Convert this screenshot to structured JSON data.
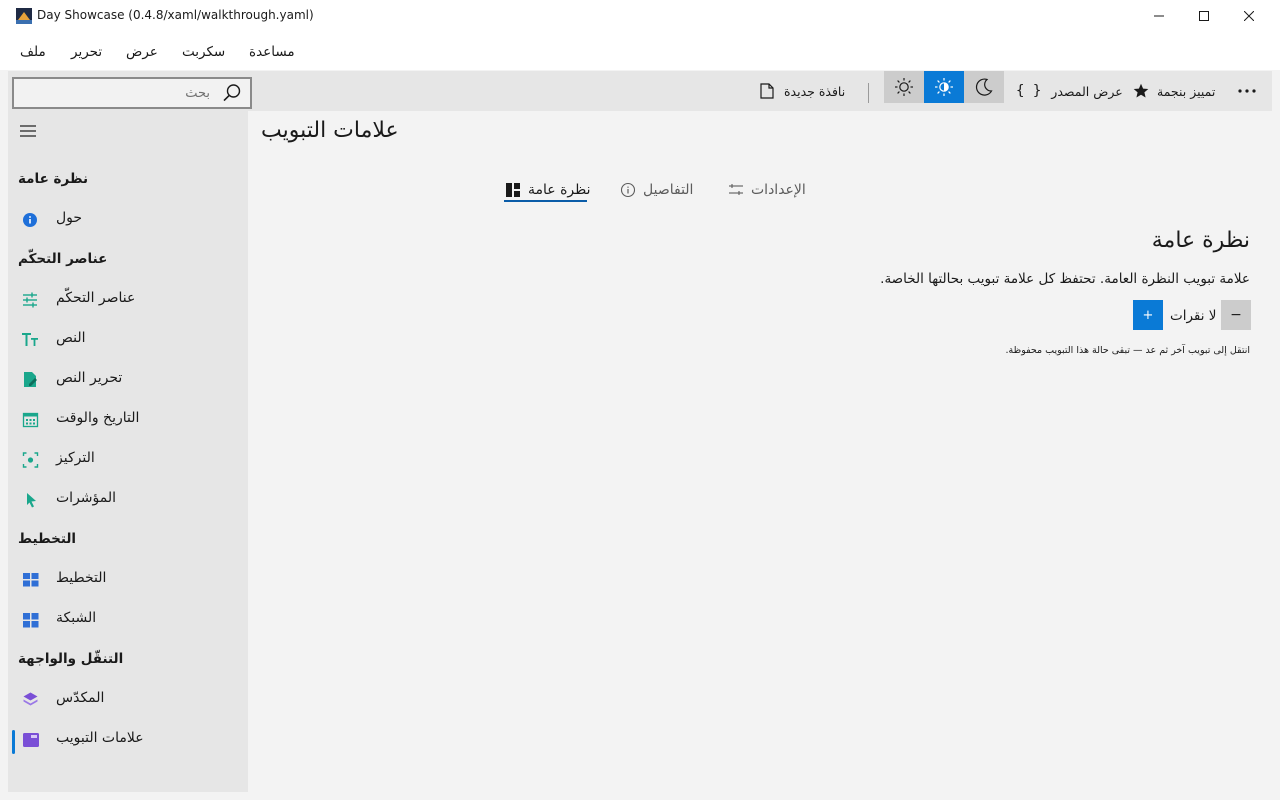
{
  "window": {
    "title": "Day Showcase (0.4.8/xaml/walkthrough.yaml)",
    "app_icon": "app-logo-icon"
  },
  "menu": {
    "file": "ملف",
    "edit": "تحرير",
    "view": "عرض",
    "script": "سكربت",
    "help": "مساعدة"
  },
  "toolbar": {
    "search_placeholder": "بحث",
    "new_window": "نافذة جديدة",
    "view_source": "عرض المصدر",
    "star": "تمييز بنجمة",
    "accent": "#0a7ad6"
  },
  "sidebar": {
    "headers": {
      "overview": "نظرة عامة",
      "controls": "عناصر التحكّم",
      "layout": "التخطيط",
      "navigation": "التنقّل والواجهة"
    },
    "items": [
      {
        "label": "حول",
        "icon": "info-icon",
        "color": "#1e6fd9"
      },
      {
        "label": "عناصر التحكّم",
        "icon": "sliders-icon",
        "color": "#1aa78c"
      },
      {
        "label": "النص",
        "icon": "text-size-icon",
        "color": "#1aa78c"
      },
      {
        "label": "تحرير النص",
        "icon": "edit-document-icon",
        "color": "#1aa78c"
      },
      {
        "label": "التاريخ والوقت",
        "icon": "calendar-icon",
        "color": "#1aa78c"
      },
      {
        "label": "التركيز",
        "icon": "focus-icon",
        "color": "#1aa78c"
      },
      {
        "label": "المؤشرات",
        "icon": "pointer-icon",
        "color": "#1aa78c"
      },
      {
        "label": "التخطيط",
        "icon": "layout-icon",
        "color": "#2f6fd6"
      },
      {
        "label": "الشبكة",
        "icon": "grid-icon",
        "color": "#2f6fd6"
      },
      {
        "label": "المكدّس",
        "icon": "stack-icon",
        "color": "#7a4fd6"
      },
      {
        "label": "علامات التبويب",
        "icon": "tabs-icon",
        "color": "#7a4fd6"
      }
    ]
  },
  "main": {
    "title": "علامات التبويب",
    "tabs": [
      {
        "label": "نظرة عامة",
        "icon": "dashboard-icon"
      },
      {
        "label": "التفاصيل",
        "icon": "info-outline-icon"
      },
      {
        "label": "الإعدادات",
        "icon": "settings-sliders-icon"
      }
    ],
    "section_title": "نظرة عامة",
    "section_desc": "علامة تبويب النظرة العامة. تحتفظ كل علامة تبويب بحالتها الخاصة.",
    "counter_label": "لا نقرات",
    "decrement": "−",
    "increment": "+",
    "hint": "انتقل إلى تبويب آخر ثم عد — تبقى حالة هذا التبويب محفوظة."
  }
}
